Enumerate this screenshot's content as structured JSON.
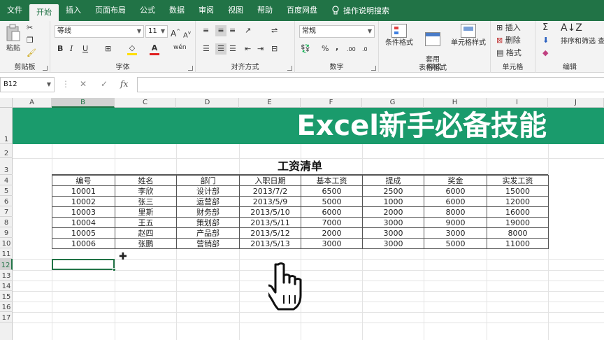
{
  "menu": {
    "tabs": [
      "文件",
      "开始",
      "插入",
      "页面布局",
      "公式",
      "数据",
      "审阅",
      "视图",
      "帮助",
      "百度网盘"
    ],
    "active_tab": "开始",
    "tell_me": "操作说明搜索"
  },
  "ribbon": {
    "clipboard": {
      "label": "剪贴板",
      "paste": "粘贴"
    },
    "font": {
      "label": "字体",
      "name": "等线",
      "size": "11",
      "bold": "B",
      "italic": "I",
      "underline": "U",
      "grow": "A",
      "shrink": "A",
      "phonetic": "wén"
    },
    "alignment": {
      "label": "对齐方式"
    },
    "number": {
      "label": "数字",
      "format": "常规",
      "percent": "%",
      "comma": ",",
      "inc_decimal": ".00",
      "dec_decimal": ".0"
    },
    "styles": {
      "label": "样式",
      "conditional": "条件格式",
      "table_format": "套用\n表格格式",
      "cell_styles": "单元格样式"
    },
    "cells": {
      "label": "单元格",
      "insert": "插入",
      "delete": "删除",
      "format": "格式"
    },
    "editing": {
      "label": "编辑",
      "sort_filter": "排序和筛选",
      "find": "查"
    }
  },
  "formula_bar": {
    "name_box": "B12",
    "cancel": "✕",
    "enter": "✓",
    "fx": "fx",
    "content": ""
  },
  "columns": [
    "A",
    "B",
    "C",
    "D",
    "E",
    "F",
    "G",
    "H",
    "I",
    "J"
  ],
  "selected_column": "B",
  "rows": [
    "1",
    "2",
    "3",
    "4",
    "5",
    "6",
    "7",
    "8",
    "9",
    "10",
    "11",
    "12",
    "13",
    "14",
    "15",
    "16",
    "17"
  ],
  "selected_row": "12",
  "sheet": {
    "banner_title": "Excel新手必备技能",
    "table_title": "工资清单",
    "headers": [
      "编号",
      "姓名",
      "部门",
      "入职日期",
      "基本工资",
      "提成",
      "奖金",
      "实发工资"
    ],
    "rows": [
      [
        "10001",
        "李欣",
        "设计部",
        "2013/7/2",
        "6500",
        "2500",
        "6000",
        "15000"
      ],
      [
        "10002",
        "张三",
        "运营部",
        "2013/5/9",
        "5000",
        "1000",
        "6000",
        "12000"
      ],
      [
        "10003",
        "里斯",
        "财务部",
        "2013/5/10",
        "6000",
        "2000",
        "8000",
        "16000"
      ],
      [
        "10004",
        "王五",
        "策划部",
        "2013/5/11",
        "7000",
        "3000",
        "9000",
        "19000"
      ],
      [
        "10005",
        "赵四",
        "产品部",
        "2013/5/12",
        "2000",
        "3000",
        "3000",
        "8000"
      ],
      [
        "10006",
        "张鹏",
        "营销部",
        "2013/5/13",
        "3000",
        "3000",
        "5000",
        "11000"
      ]
    ]
  },
  "colors": {
    "excel_green": "#217346",
    "banner": "#1a9b6c"
  }
}
